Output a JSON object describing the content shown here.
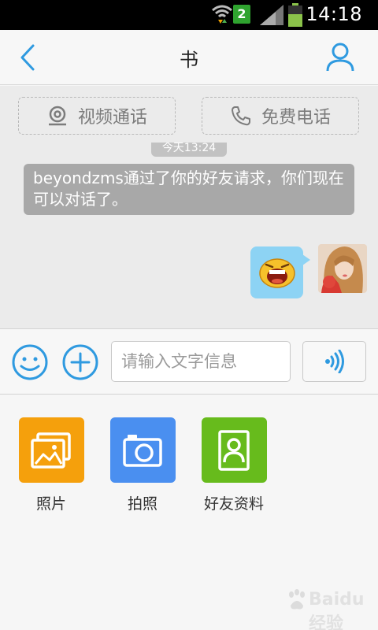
{
  "status_bar": {
    "time": "14:18",
    "sim_label": "2"
  },
  "header": {
    "title": "书"
  },
  "call_actions": {
    "video_call_label": "视频通话",
    "free_call_label": "免费电话"
  },
  "chat": {
    "timestamp": "今天13:24",
    "system_message": "beyondzms通过了你的好友请求，你们现在可以对话了。"
  },
  "composer": {
    "placeholder": "请输入文字信息"
  },
  "panel": {
    "items": [
      {
        "label": "照片",
        "icon": "photo-icon",
        "color": "#f5a00c"
      },
      {
        "label": "拍照",
        "icon": "camera-icon",
        "color": "#4a8ff0"
      },
      {
        "label": "好友资料",
        "icon": "contact-card-icon",
        "color": "#67bb1c"
      }
    ]
  },
  "colors": {
    "accent": "#2f9ae0",
    "bubble": "#8dd3f4",
    "system_bubble": "#a8a8a8"
  },
  "watermark_text": "Baidu 经验"
}
